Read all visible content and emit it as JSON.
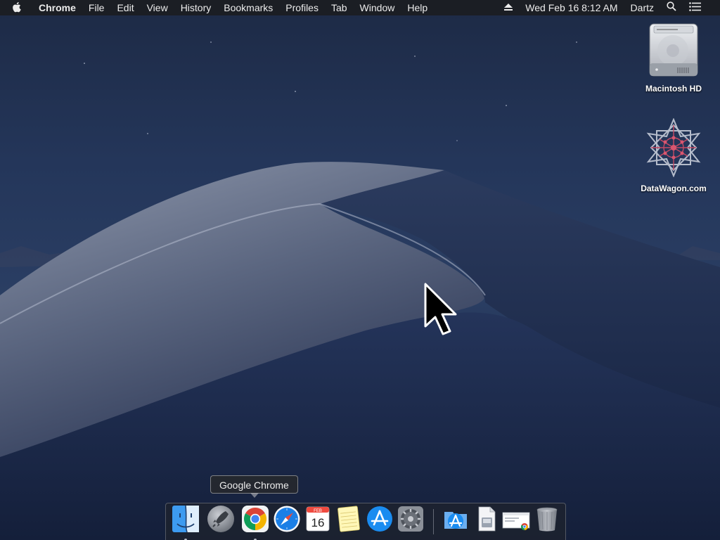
{
  "menubar": {
    "app_name": "Chrome",
    "menus": [
      "File",
      "Edit",
      "View",
      "History",
      "Bookmarks",
      "Profiles",
      "Tab",
      "Window",
      "Help"
    ],
    "clock": "Wed Feb 16  8:12 AM",
    "user": "Dartz",
    "icons": [
      "apple-icon",
      "eject-icon",
      "spotlight-search-icon",
      "notification-center-icon"
    ]
  },
  "desktop_icons": [
    {
      "label": "Macintosh HD",
      "icon": "hard-drive-icon"
    },
    {
      "label": "DataWagon.com",
      "icon": "datawagon-logo-icon"
    }
  ],
  "dock": {
    "tooltip": "Google Chrome",
    "calendar_month": "FEB",
    "calendar_day": "16",
    "items": [
      {
        "name": "Finder",
        "icon": "finder-icon",
        "running": true
      },
      {
        "name": "Launchpad",
        "icon": "launchpad-icon",
        "running": false
      },
      {
        "name": "Google Chrome",
        "icon": "chrome-icon",
        "running": true
      },
      {
        "name": "Safari",
        "icon": "safari-icon",
        "running": false
      },
      {
        "name": "Calendar",
        "icon": "calendar-icon",
        "running": false
      },
      {
        "name": "Notes",
        "icon": "notes-icon",
        "running": false
      },
      {
        "name": "App Store",
        "icon": "app-store-icon",
        "running": false
      },
      {
        "name": "System Preferences",
        "icon": "system-preferences-icon",
        "running": false
      },
      {
        "name": "Applications",
        "icon": "applications-folder-icon",
        "running": false
      },
      {
        "name": "Document",
        "icon": "document-icon",
        "running": false
      },
      {
        "name": "Downloads",
        "icon": "downloads-stack-icon",
        "running": false
      },
      {
        "name": "Trash",
        "icon": "trash-icon",
        "running": false
      }
    ]
  },
  "colors": {
    "menubar_bg": "#1b1e24",
    "chrome_red": "#db4437",
    "chrome_yellow": "#f4b400",
    "chrome_green": "#0f9d58",
    "chrome_blue": "#4285f4",
    "safari_blue": "#1b7fe6",
    "app_store_blue": "#1a8cf0"
  }
}
